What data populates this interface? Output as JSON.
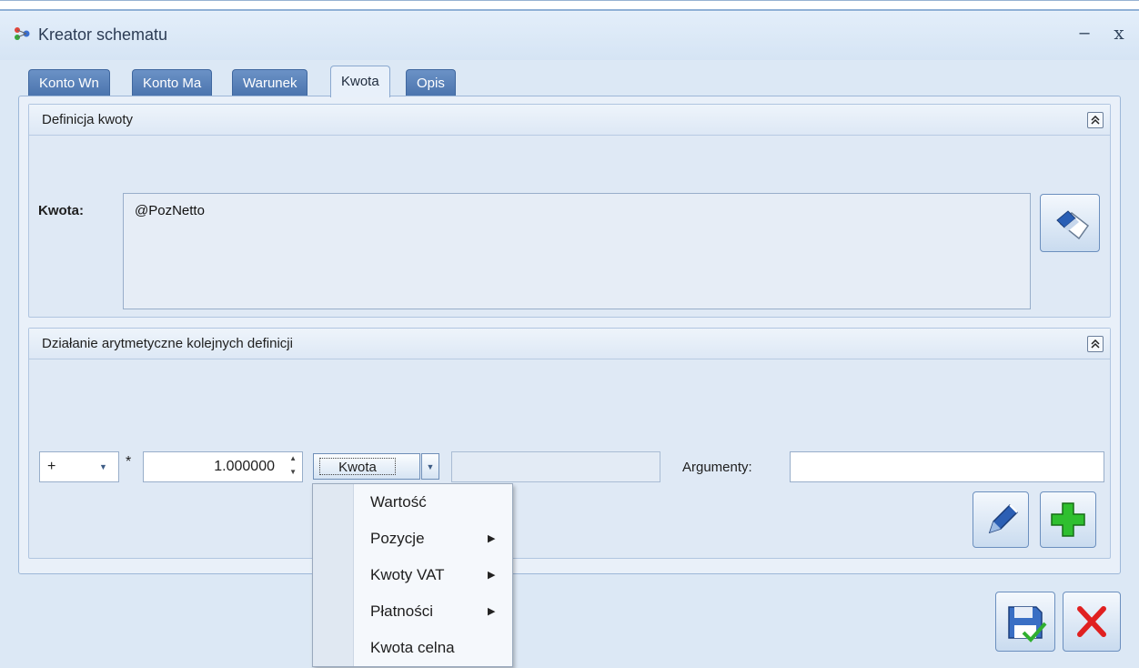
{
  "window": {
    "title": "Kreator schematu",
    "minimize_label": "–",
    "close_label": "x",
    "icon": "app-logo-icon"
  },
  "tabs": [
    {
      "label": "Konto Wn",
      "active": false
    },
    {
      "label": "Konto Ma",
      "active": false
    },
    {
      "label": "Warunek",
      "active": false
    },
    {
      "label": "Kwota",
      "active": true
    },
    {
      "label": "Opis",
      "active": false
    }
  ],
  "definicja": {
    "header": "Definicja kwoty",
    "collapse_icon": "collapse-up-icon",
    "label": "Kwota:",
    "value": "@PozNetto",
    "edit_icon": "eraser-icon"
  },
  "dzialanie": {
    "header": "Działanie arytmetyczne kolejnych definicji",
    "collapse_icon": "collapse-up-icon",
    "operator": "+",
    "multiply_symbol": "*",
    "multiplier": "1.000000",
    "kwota_combo": "Kwota",
    "extra_field": "",
    "argumenty_label": "Argumenty:",
    "argumenty_value": "",
    "edit_icon": "pencil-icon",
    "add_icon": "plus-icon"
  },
  "menu": {
    "items": [
      {
        "label": "Wartość",
        "submenu": false
      },
      {
        "label": "Pozycje",
        "submenu": true
      },
      {
        "label": "Kwoty VAT",
        "submenu": true
      },
      {
        "label": "Płatności",
        "submenu": true
      },
      {
        "label": "Kwota celna",
        "submenu": false
      }
    ]
  },
  "footer": {
    "save_icon": "save-icon",
    "cancel_icon": "cancel-x-icon"
  },
  "colors": {
    "tab_blue": "#4a73ad",
    "panel_bg": "#e9f0f9",
    "cancel_red": "#e02020",
    "add_green": "#2fbf2f"
  }
}
